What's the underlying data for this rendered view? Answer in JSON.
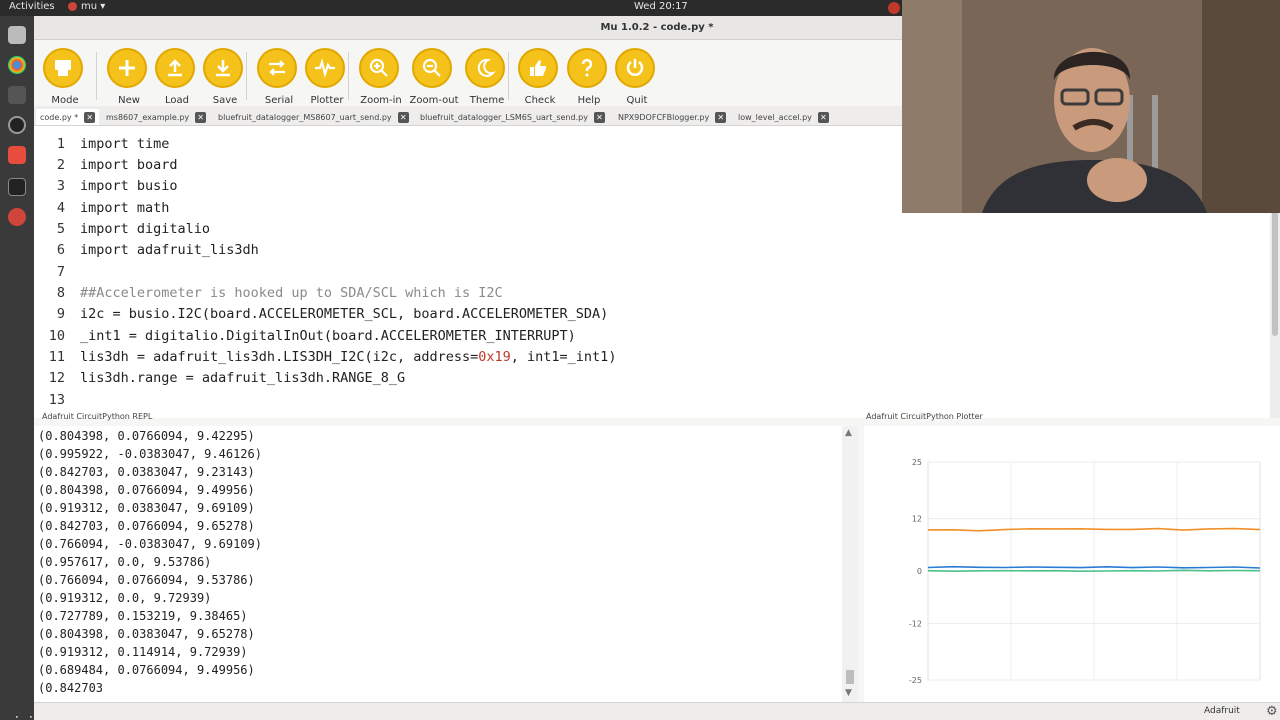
{
  "topbar": {
    "activities": "Activities",
    "app_menu": "mu ▾",
    "clock": "Wed 20:17"
  },
  "window": {
    "title": "Mu 1.0.2 - code.py *"
  },
  "toolbar": {
    "buttons": [
      {
        "label": "Mode",
        "icon": "mode-icon"
      },
      {
        "label": "New",
        "icon": "plus-icon"
      },
      {
        "label": "Load",
        "icon": "upload-icon"
      },
      {
        "label": "Save",
        "icon": "download-icon"
      },
      {
        "label": "Serial",
        "icon": "arrows-icon"
      },
      {
        "label": "Plotter",
        "icon": "pulse-icon"
      },
      {
        "label": "Zoom-in",
        "icon": "zoom-in-icon"
      },
      {
        "label": "Zoom-out",
        "icon": "zoom-out-icon"
      },
      {
        "label": "Theme",
        "icon": "moon-icon"
      },
      {
        "label": "Check",
        "icon": "thumbs-up-icon"
      },
      {
        "label": "Help",
        "icon": "question-icon"
      },
      {
        "label": "Quit",
        "icon": "power-icon"
      }
    ]
  },
  "tabs": [
    {
      "label": "code.py *",
      "active": true
    },
    {
      "label": "ms8607_example.py"
    },
    {
      "label": "bluefruit_datalogger_MS8607_uart_send.py"
    },
    {
      "label": "bluefruit_datalogger_LSM6S_uart_send.py"
    },
    {
      "label": "NPX9DOFCFBlogger.py"
    },
    {
      "label": "low_level_accel.py"
    }
  ],
  "editor": {
    "lines": [
      {
        "n": "1",
        "code": "import time"
      },
      {
        "n": "2",
        "code": "import board"
      },
      {
        "n": "3",
        "code": "import busio"
      },
      {
        "n": "4",
        "code": "import math"
      },
      {
        "n": "5",
        "code": "import digitalio"
      },
      {
        "n": "6",
        "code": "import adafruit_lis3dh"
      },
      {
        "n": "7",
        "code": ""
      },
      {
        "n": "8",
        "code": "##Accelerometer is hooked up to SDA/SCL which is I2C"
      },
      {
        "n": "9",
        "code": "i2c = busio.I2C(board.ACCELEROMETER_SCL, board.ACCELEROMETER_SDA)"
      },
      {
        "n": "10",
        "code": "_int1 = digitalio.DigitalInOut(board.ACCELEROMETER_INTERRUPT)"
      },
      {
        "n": "11",
        "code_a": "lis3dh = adafruit_lis3dh.LIS3DH_I2C(i2c, address=",
        "code_hl": "0x19",
        "code_b": ", int1=_int1)"
      },
      {
        "n": "12",
        "code": "lis3dh.range = adafruit_lis3dh.RANGE_8_G"
      },
      {
        "n": "13",
        "code": ""
      }
    ]
  },
  "repl": {
    "title": "Adafruit CircuitPython REPL",
    "lines": [
      "(0.804398, 0.0766094, 9.42295)",
      "(0.995922, -0.0383047, 9.46126)",
      "(0.842703, 0.0383047, 9.23143)",
      "(0.804398, 0.0766094, 9.49956)",
      "(0.919312, 0.0383047, 9.69109)",
      "(0.842703, 0.0766094, 9.65278)",
      "(0.766094, -0.0383047, 9.69109)",
      "(0.957617, 0.0, 9.53786)",
      "(0.766094, 0.0766094, 9.53786)",
      "(0.919312, 0.0, 9.72939)",
      "(0.727789, 0.153219, 9.38465)",
      "(0.804398, 0.0383047, 9.65278)",
      "(0.919312, 0.114914, 9.72939)",
      "(0.689484, 0.0766094, 9.49956)",
      "(0.842703"
    ]
  },
  "plotter": {
    "title": "Adafruit CircuitPython Plotter",
    "colors": {
      "x": "#2a7bd4",
      "y": "#4bc08a",
      "z": "#f0902a"
    }
  },
  "chart_data": {
    "type": "line",
    "yticks": [
      "25",
      "12",
      "0",
      "-12",
      "-25"
    ],
    "ylim": [
      -25,
      25
    ],
    "grid": true,
    "series": [
      {
        "values": [
          0.8,
          0.99,
          0.84,
          0.8,
          0.92,
          0.84,
          0.77,
          0.96,
          0.77,
          0.92,
          0.73,
          0.8,
          0.92,
          0.69
        ]
      },
      {
        "values": [
          0.08,
          -0.04,
          0.04,
          0.08,
          0.04,
          0.08,
          -0.04,
          0.0,
          0.08,
          0.0,
          0.15,
          0.04,
          0.11,
          0.08
        ]
      },
      {
        "values": [
          9.42,
          9.46,
          9.23,
          9.5,
          9.69,
          9.65,
          9.69,
          9.54,
          9.54,
          9.73,
          9.38,
          9.65,
          9.73,
          9.5
        ]
      }
    ]
  },
  "statusbar": {
    "mode": "Adafruit"
  }
}
